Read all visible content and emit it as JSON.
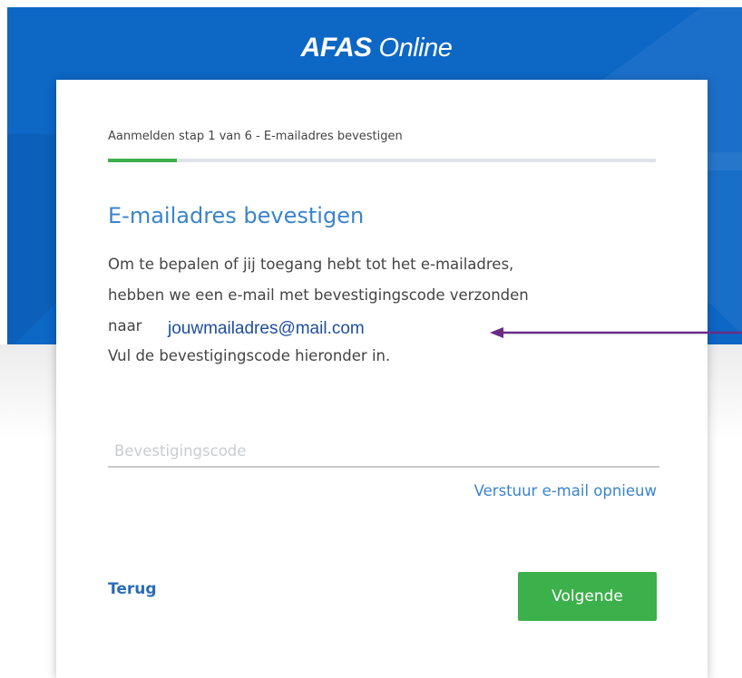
{
  "colors": {
    "brand_blue": "#0d67c5",
    "accent_green": "#3cb04b",
    "link_blue": "#3a84cc",
    "annotation_purple": "#6a2a86"
  },
  "header": {
    "logo_brand": "AFAS",
    "logo_suffix": "Online"
  },
  "signup": {
    "step_label": "Aanmelden stap 1 van 6 - E-mailadres bevestigen",
    "progress_fraction": 0.125,
    "heading": "E-mailadres bevestigen",
    "body_line1": "Om te bepalen of jij toegang hebt tot het e-mailadres,",
    "body_line2": "hebben we een e-mail met bevestigingscode verzonden",
    "body_line3_prefix": "naar",
    "email": "jouwmailadres@mail.com",
    "body_line4": "Vul de bevestigingscode hieronder in.",
    "code_input": {
      "value": "",
      "placeholder": "Bevestigingscode"
    },
    "resend_label": "Verstuur e-mail opnieuw",
    "back_label": "Terug",
    "next_label": "Volgende"
  },
  "annotation": {
    "icon": "arrow-left-icon"
  }
}
